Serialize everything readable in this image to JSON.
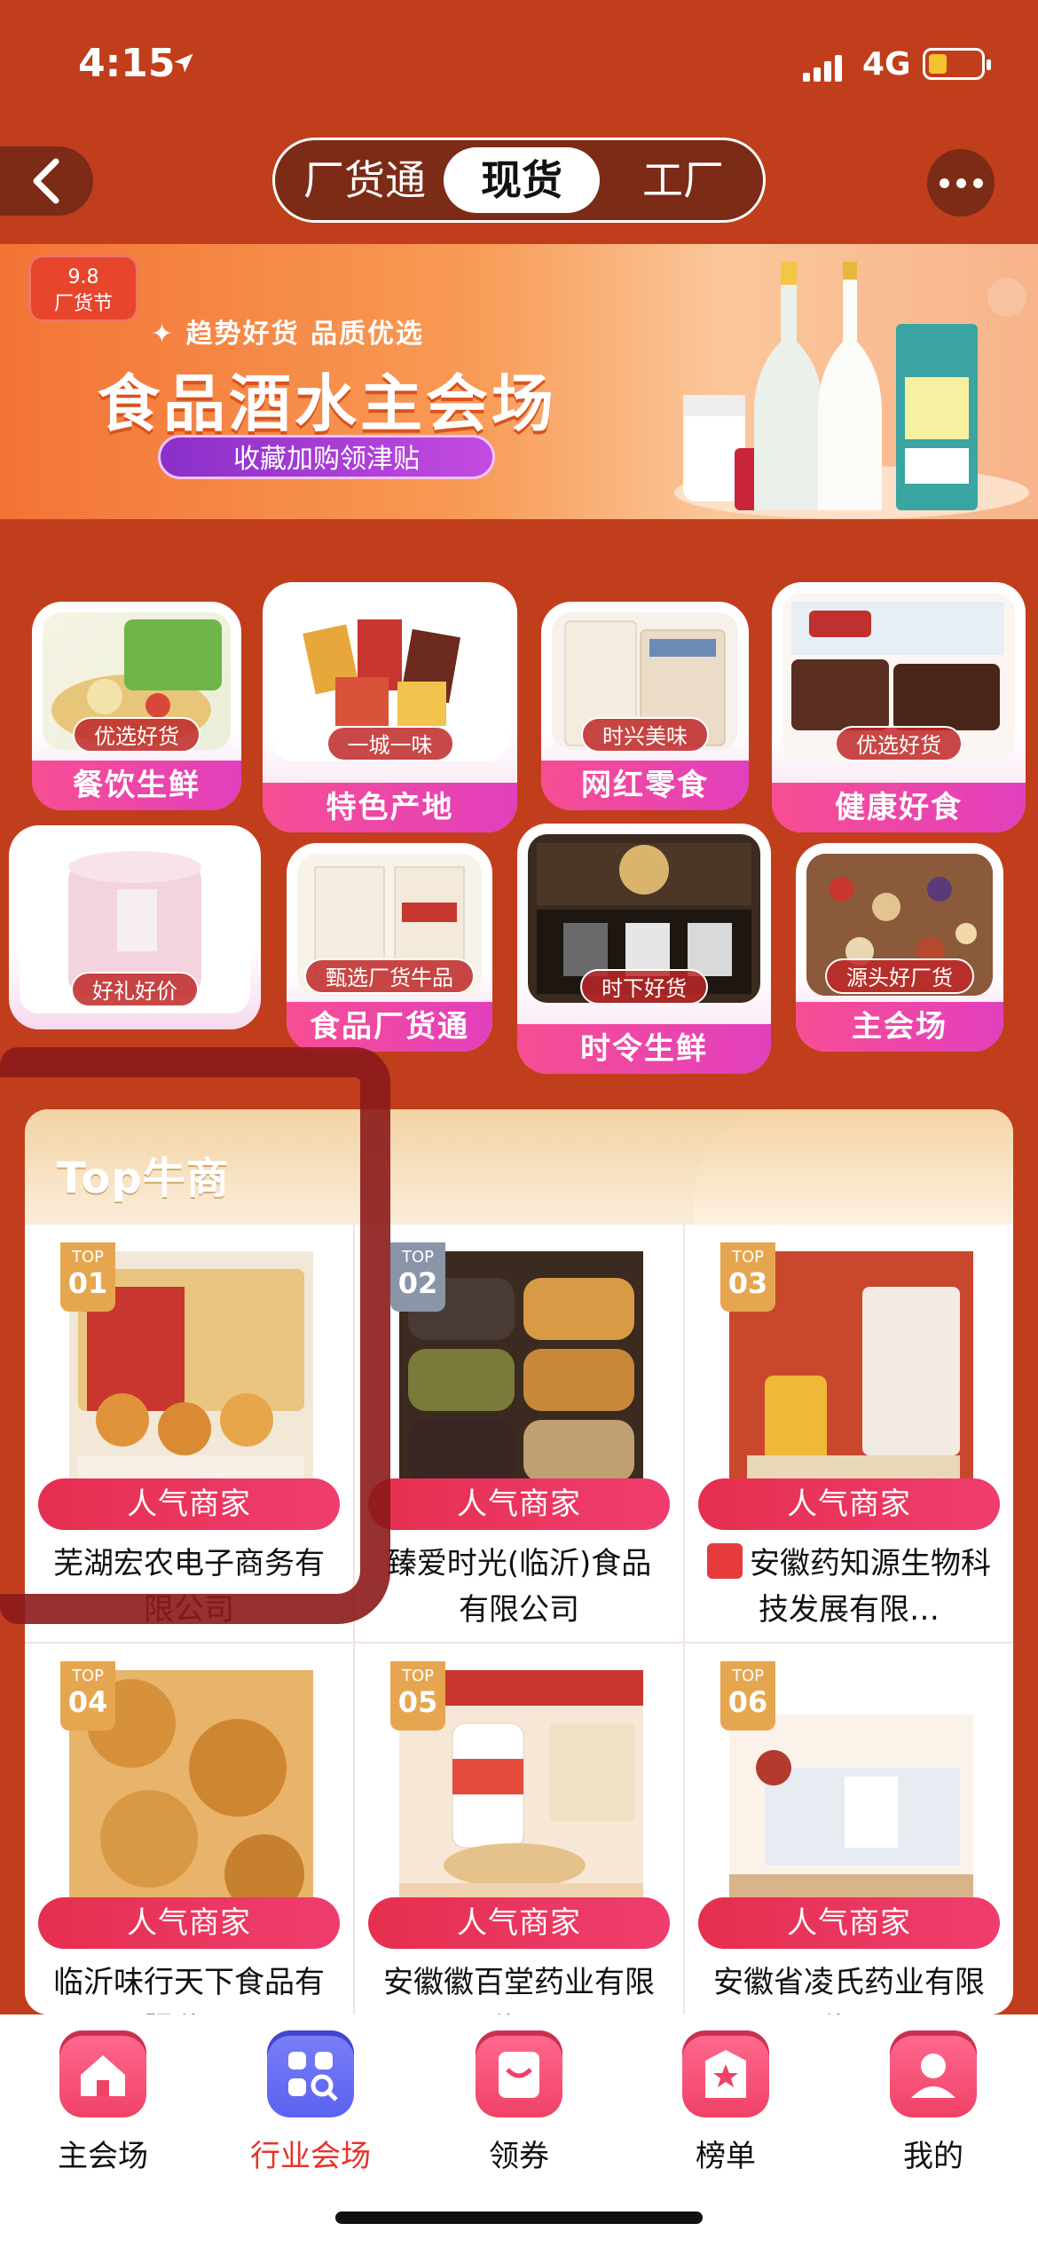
{
  "status": {
    "time": "4:15",
    "network": "4G"
  },
  "nav": {
    "tabs": [
      "厂货通",
      "现货",
      "工厂"
    ],
    "active_tab": "现货"
  },
  "banner": {
    "badge": "9.8\n厂货节",
    "subtitle": "✦ 趋势好货 品质优选",
    "title": "食品酒水主会场",
    "cta": "收藏加购领津贴"
  },
  "categories": [
    {
      "label": "餐饮生鲜",
      "tag": "优选好货"
    },
    {
      "label": "特色产地",
      "tag": "一城一味"
    },
    {
      "label": "网红零食",
      "tag": "时兴美味"
    },
    {
      "label": "健康好食",
      "tag": "优选好货"
    },
    {
      "label": "好礼好价",
      "tag": "好礼好价"
    },
    {
      "label": "食品厂货通",
      "tag": "甄选厂货牛品"
    },
    {
      "label": "时令生鲜",
      "tag": "时下好货"
    },
    {
      "label": "主会场",
      "tag": "源头好厂货"
    }
  ],
  "top": {
    "title": "Top牛商",
    "items": [
      {
        "rank": "01",
        "badge": "人气商家",
        "name": "芜湖宏农电子商务有限公司"
      },
      {
        "rank": "02",
        "badge": "人气商家",
        "name": "臻爱时光(临沂)食品有限公司"
      },
      {
        "rank": "03",
        "badge": "人气商家",
        "name": "安徽药知源生物科技发展有限…"
      },
      {
        "rank": "04",
        "badge": "人气商家",
        "name": "临沂味行天下食品有限公司"
      },
      {
        "rank": "05",
        "badge": "人气商家",
        "name": "安徽徽百堂药业有限公司"
      },
      {
        "rank": "06",
        "badge": "人气商家",
        "name": "安徽省凌氏药业有限公司"
      }
    ]
  },
  "tabbar": {
    "items": [
      {
        "label": "主会场",
        "icon": "home-icon"
      },
      {
        "label": "行业会场",
        "icon": "grid-icon",
        "active": true
      },
      {
        "label": "领券",
        "icon": "coupon-icon"
      },
      {
        "label": "榜单",
        "icon": "ranking-icon"
      },
      {
        "label": "我的",
        "icon": "profile-icon"
      }
    ]
  },
  "colors": {
    "background": "#c13e1c",
    "accent": "#e5342b",
    "badge_pink": "#ef3d6e"
  }
}
